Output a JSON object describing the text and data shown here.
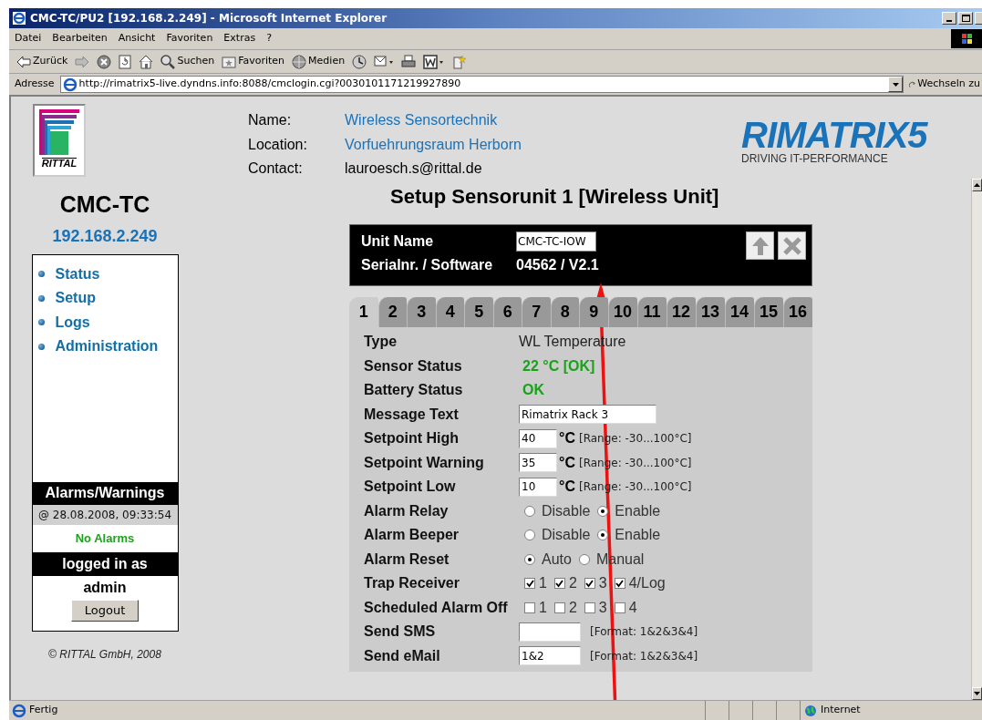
{
  "window": {
    "title": "CMC-TC/PU2 [192.168.2.249] - Microsoft Internet Explorer"
  },
  "menu": [
    "Datei",
    "Bearbeiten",
    "Ansicht",
    "Favoriten",
    "Extras",
    "?"
  ],
  "toolbar": [
    {
      "kind": "back",
      "label": "Zurück"
    },
    {
      "kind": "forward"
    },
    {
      "kind": "stop"
    },
    {
      "kind": "refresh"
    },
    {
      "kind": "home"
    },
    {
      "kind": "search",
      "label": "Suchen"
    },
    {
      "kind": "favorites",
      "label": "Favoriten"
    },
    {
      "kind": "media",
      "label": "Medien"
    },
    {
      "kind": "history"
    },
    {
      "kind": "mail"
    },
    {
      "kind": "print"
    },
    {
      "kind": "edit"
    },
    {
      "kind": "messenger"
    }
  ],
  "address": {
    "label": "Adresse",
    "value": "http://rimatrix5-live.dyndns.info:8088/cmclogin.cgi?0030101171219927890",
    "go": "Wechseln zu"
  },
  "sidebar": {
    "logo": "RITTAL",
    "device": "CMC-TC",
    "ip": "192.168.2.249",
    "nav": [
      {
        "label": "Status"
      },
      {
        "label": "Setup"
      },
      {
        "label": "Logs"
      },
      {
        "label": "Administration"
      }
    ],
    "alarms_title": "Alarms/Warnings",
    "alarms_time": "@ 28.08.2008, 09:33:54",
    "alarms_status": "No Alarms",
    "login_title": "logged in as",
    "user": "admin",
    "logout": "Logout",
    "copyright": "© RITTAL GmbH, 2008"
  },
  "info": [
    {
      "label": "Name:",
      "value": "Wireless Sensortechnik",
      "link": true
    },
    {
      "label": "Location:",
      "value": "Vorfuehrungsraum Herborn",
      "link": true
    },
    {
      "label": "Contact:",
      "value": "lauroesch.s@rittal.de",
      "link": false
    }
  ],
  "brand": {
    "name": "RIMATRIX5",
    "tagline": "DRIVING IT-PERFORMANCE"
  },
  "heading": "Setup Sensorunit 1 [Wireless Unit]",
  "unit": {
    "name_label": "Unit Name",
    "name_value": "CMC-TC-IOW",
    "serial_label": "Serialnr. / Software",
    "serial_value": "04562 / V2.1"
  },
  "tabs": [
    {
      "label": "1",
      "selected": true
    },
    {
      "label": "2",
      "selected": false
    },
    {
      "label": "3",
      "selected": false
    },
    {
      "label": "4",
      "selected": false
    },
    {
      "label": "5",
      "selected": false
    },
    {
      "label": "6",
      "selected": false
    },
    {
      "label": "7",
      "selected": false
    },
    {
      "label": "8",
      "selected": false
    },
    {
      "label": "9",
      "selected": false
    },
    {
      "label": "10",
      "selected": false
    },
    {
      "label": "11",
      "selected": false
    },
    {
      "label": "12",
      "selected": false
    },
    {
      "label": "13",
      "selected": false
    },
    {
      "label": "14",
      "selected": false
    },
    {
      "label": "15",
      "selected": false
    },
    {
      "label": "16",
      "selected": false
    }
  ],
  "rows": [
    {
      "label": "Type",
      "kind": "text",
      "value": "WL Temperature"
    },
    {
      "label": "Sensor Status",
      "kind": "status",
      "value": "22 °C [OK]"
    },
    {
      "label": "Battery Status",
      "kind": "status",
      "value": "OK"
    },
    {
      "label": "Message Text",
      "kind": "input",
      "value": "Rimatrix Rack 3"
    },
    {
      "label": "Setpoint High",
      "kind": "setpoint",
      "value": "40",
      "unit": "°C",
      "range": "[Range: -30...100°C]"
    },
    {
      "label": "Setpoint Warning",
      "kind": "setpoint",
      "value": "35",
      "unit": "°C",
      "range": "[Range: -30...100°C]"
    },
    {
      "label": "Setpoint Low",
      "kind": "setpoint",
      "value": "10",
      "unit": "°C",
      "range": "[Range: -30...100°C]"
    },
    {
      "label": "Alarm Relay",
      "kind": "radio",
      "options": [
        {
          "label": "Disable",
          "selected": false
        },
        {
          "label": "Enable",
          "selected": true
        }
      ]
    },
    {
      "label": "Alarm Beeper",
      "kind": "radio",
      "options": [
        {
          "label": "Disable",
          "selected": false
        },
        {
          "label": "Enable",
          "selected": true
        }
      ]
    },
    {
      "label": "Alarm Reset",
      "kind": "radio",
      "options": [
        {
          "label": "Auto",
          "selected": true
        },
        {
          "label": "Manual",
          "selected": false
        }
      ]
    },
    {
      "label": "Trap Receiver",
      "kind": "checks",
      "options": [
        {
          "label": "1",
          "checked": true
        },
        {
          "label": "2",
          "checked": true
        },
        {
          "label": "3",
          "checked": true
        },
        {
          "label": "4/Log",
          "checked": true
        }
      ]
    },
    {
      "label": "Scheduled Alarm Off",
      "kind": "checks",
      "options": [
        {
          "label": "1",
          "checked": false
        },
        {
          "label": "2",
          "checked": false
        },
        {
          "label": "3",
          "checked": false
        },
        {
          "label": "4",
          "checked": false
        }
      ]
    },
    {
      "label": "Send SMS",
      "kind": "format",
      "value": "",
      "note": "[Format: 1&2&3&4]"
    },
    {
      "label": "Send eMail",
      "kind": "format",
      "value": "1&2",
      "note": "[Format: 1&2&3&4]"
    }
  ],
  "status_bar": {
    "text": "Fertig",
    "zone": "Internet"
  }
}
